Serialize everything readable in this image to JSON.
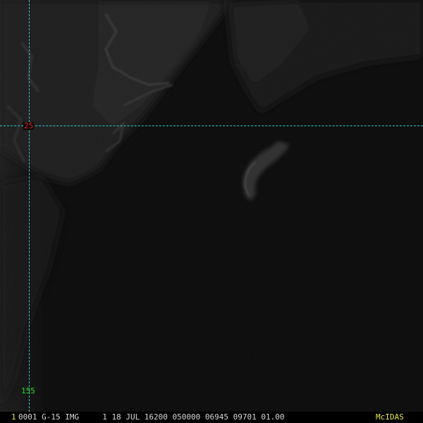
{
  "overlay": {
    "latitude_label": "25",
    "longitude_label": "155"
  },
  "status_bar": {
    "frame_number": "1",
    "text": "0001 G-15 IMG     1 18 JUL 16200 050000 06945 09701 01.00",
    "product_label": "McIDAS"
  },
  "colors": {
    "gridline": "#35c4cc",
    "latitude_label": "#e02020",
    "longitude_label": "#20e020",
    "frame_number": "#e8e84a",
    "product_label": "#e8e84a",
    "status_text": "#d8d8d8",
    "background": "#080808"
  }
}
